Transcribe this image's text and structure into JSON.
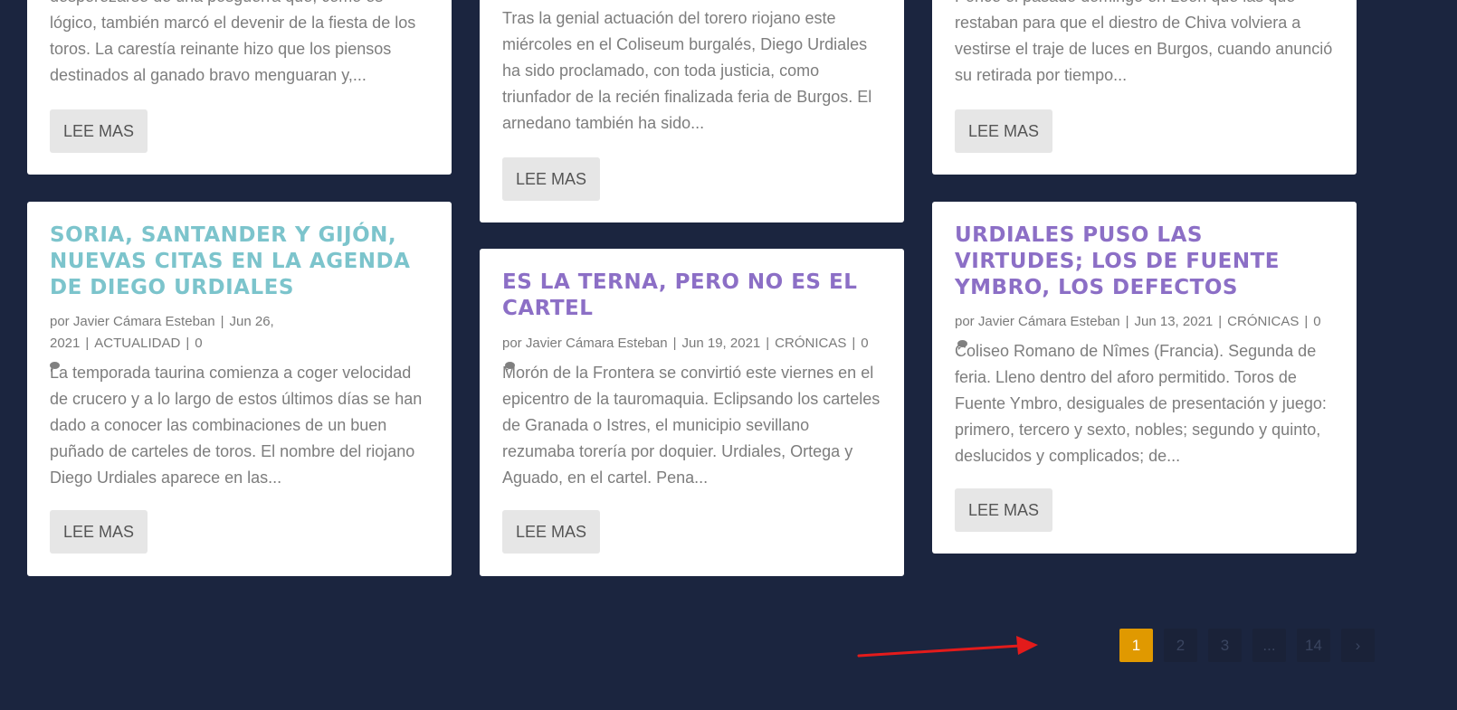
{
  "colors": {
    "title_teal": "#7cc4cc",
    "title_purple": "#8c6fc6",
    "page_active": "#e09900",
    "annotation_arrow": "#e31b1b"
  },
  "cards": [
    {
      "excerpt": "desperezarse de una posguerra que, como es lógico, también marcó el devenir de la fiesta de los toros. La carestía reinante hizo que los piensos destinados al ganado bravo menguaran y,...",
      "button": "LEE MAS"
    },
    {
      "excerpt": "Tras la genial actuación del torero riojano este miércoles en el Coliseum burgalés, Diego Urdiales ha sido proclamado, con toda justicia, como triunfador de la recién finalizada feria de Burgos. El arnedano también ha sido...",
      "button": "LEE MAS"
    },
    {
      "excerpt": "Ponce el pasado domingo en León que las que restaban para que el diestro de Chiva volviera a vestirse el traje de luces en Burgos, cuando anunció su retirada por tiempo...",
      "button": "LEE MAS"
    },
    {
      "title": "SORIA, SANTANDER Y GIJÓN, NUEVAS CITAS EN LA AGENDA DE DIEGO URDIALES",
      "author_prefix": "por",
      "author": "Javier Cámara Esteban",
      "date": "Jun 26, 2021",
      "category": "ACTUALIDAD",
      "comments": "0",
      "excerpt": "La temporada taurina comienza a coger velocidad de crucero y a lo largo de estos últimos días se han dado a conocer las combinaciones de un buen puñado de carteles de toros. El nombre del riojano Diego Urdiales aparece en las...",
      "button": "LEE MAS"
    },
    {
      "title": "ES LA TERNA, PERO NO ES EL CARTEL",
      "author_prefix": "por",
      "author": "Javier Cámara Esteban",
      "date": "Jun 19, 2021",
      "category": "CRÓNICAS",
      "comments": "0",
      "excerpt": "Morón de la Frontera se convirtió este viernes en el epicentro de la tauromaquia. Eclipsando los carteles de Granada o Istres, el municipio sevillano rezumaba torería por doquier. Urdiales, Ortega y Aguado, en el cartel. Pena...",
      "button": "LEE MAS"
    },
    {
      "title": "URDIALES PUSO LAS VIRTUDES; LOS DE FUENTE YMBRO, LOS DEFECTOS",
      "author_prefix": "por",
      "author": "Javier Cámara Esteban",
      "date": "Jun 13, 2021",
      "category": "CRÓNICAS",
      "comments": "0",
      "excerpt": "Coliseo Romano de Nîmes (Francia). Segunda de feria. Lleno dentro del aforo permitido. Toros de Fuente Ymbro, desiguales de presentación y juego: primero, tercero y sexto, nobles; segundo y quinto, deslucidos y complicados; de...",
      "button": "LEE MAS"
    }
  ],
  "pagination": {
    "pages": [
      "1",
      "2",
      "3",
      "...",
      "14"
    ],
    "active": "1",
    "next": "›"
  }
}
